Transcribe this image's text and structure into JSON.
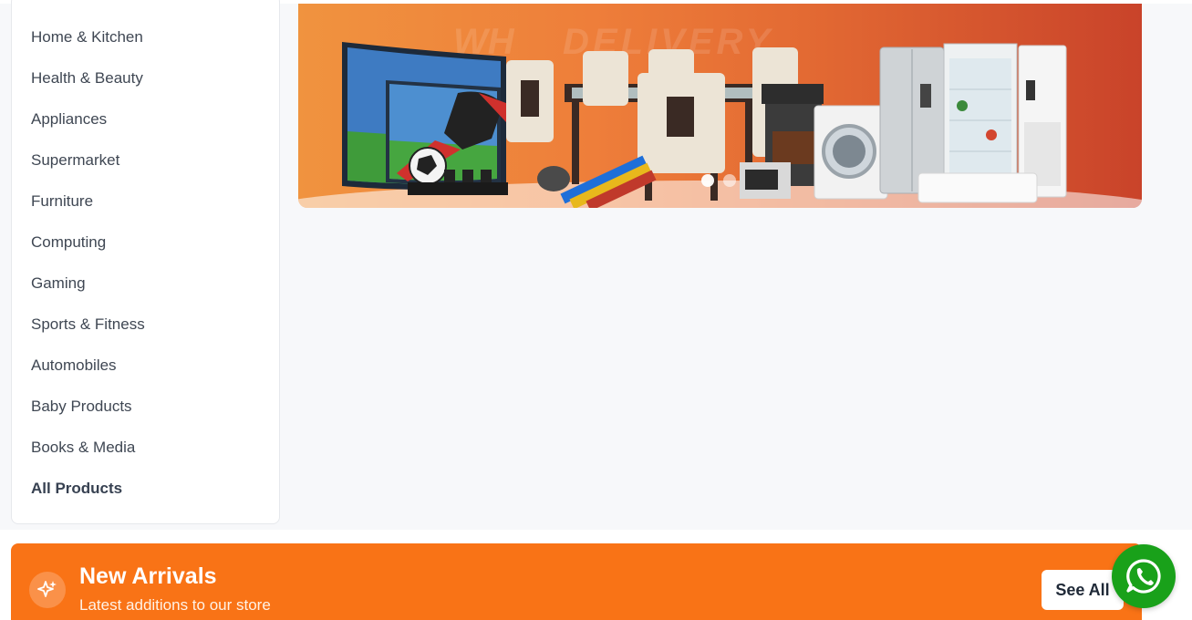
{
  "sidebar": {
    "items": [
      {
        "label": "Home & Kitchen"
      },
      {
        "label": "Health & Beauty"
      },
      {
        "label": "Appliances"
      },
      {
        "label": "Supermarket"
      },
      {
        "label": "Furniture"
      },
      {
        "label": "Computing"
      },
      {
        "label": "Gaming"
      },
      {
        "label": "Sports & Fitness"
      },
      {
        "label": "Automobiles"
      },
      {
        "label": "Baby Products"
      },
      {
        "label": "Books & Media"
      }
    ],
    "all_products_label": "All Products"
  },
  "banner": {
    "watermark_text": "DELIVERY",
    "watermark_logo": "WH",
    "slide_count": 2,
    "active_slide": 1
  },
  "new_arrivals": {
    "title": "New Arrivals",
    "subtitle": "Latest additions to our store",
    "see_all_label": "See All",
    "icon": "sparkles-icon"
  },
  "whatsapp": {
    "icon": "whatsapp-icon",
    "color": "#19a11a"
  },
  "colors": {
    "accent": "#f97316",
    "sidebar_text": "#3f4753",
    "page_bg": "#f7f8fa"
  }
}
